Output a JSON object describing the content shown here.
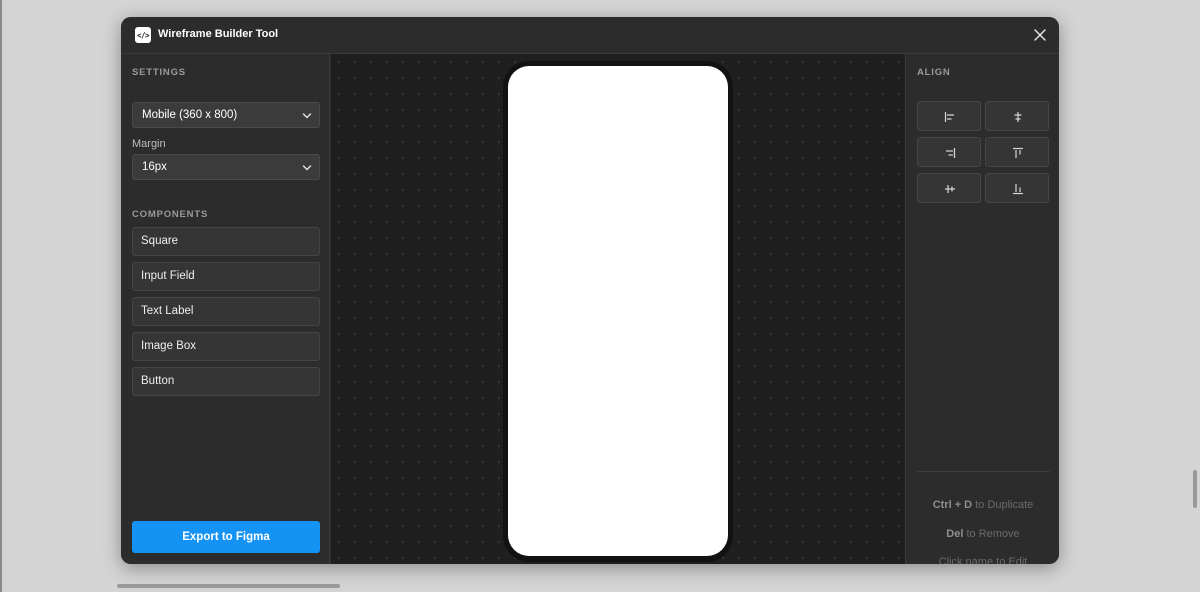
{
  "app": {
    "icon_glyph": "</>",
    "title": "Wireframe Builder Tool"
  },
  "settings": {
    "section_label": "SETTINGS",
    "device_select_value": "Mobile (360 x 800)",
    "margin_label": "Margin",
    "margin_select_value": "16px"
  },
  "components": {
    "section_label": "COMPONENTS",
    "items": [
      {
        "label": "Square"
      },
      {
        "label": "Input Field"
      },
      {
        "label": "Text Label"
      },
      {
        "label": "Image Box"
      },
      {
        "label": "Button"
      }
    ]
  },
  "export": {
    "label": "Export to Figma"
  },
  "align": {
    "section_label": "ALIGN",
    "buttons": [
      {
        "icon": "align-left-icon"
      },
      {
        "icon": "align-horizontal-center-icon"
      },
      {
        "icon": "align-right-icon"
      },
      {
        "icon": "align-top-icon"
      },
      {
        "icon": "align-vertical-center-icon"
      },
      {
        "icon": "align-bottom-icon"
      }
    ]
  },
  "hints": {
    "duplicate_key": "Ctrl + D",
    "duplicate_text": "to Duplicate",
    "remove_key": "Del",
    "remove_text": "to Remove",
    "edit_text": "Click name to Edit"
  },
  "colors": {
    "accent": "#1593f5",
    "panel": "#2c2c2c",
    "canvas": "#1f1f1f",
    "page_background": "#d4d4d4"
  }
}
